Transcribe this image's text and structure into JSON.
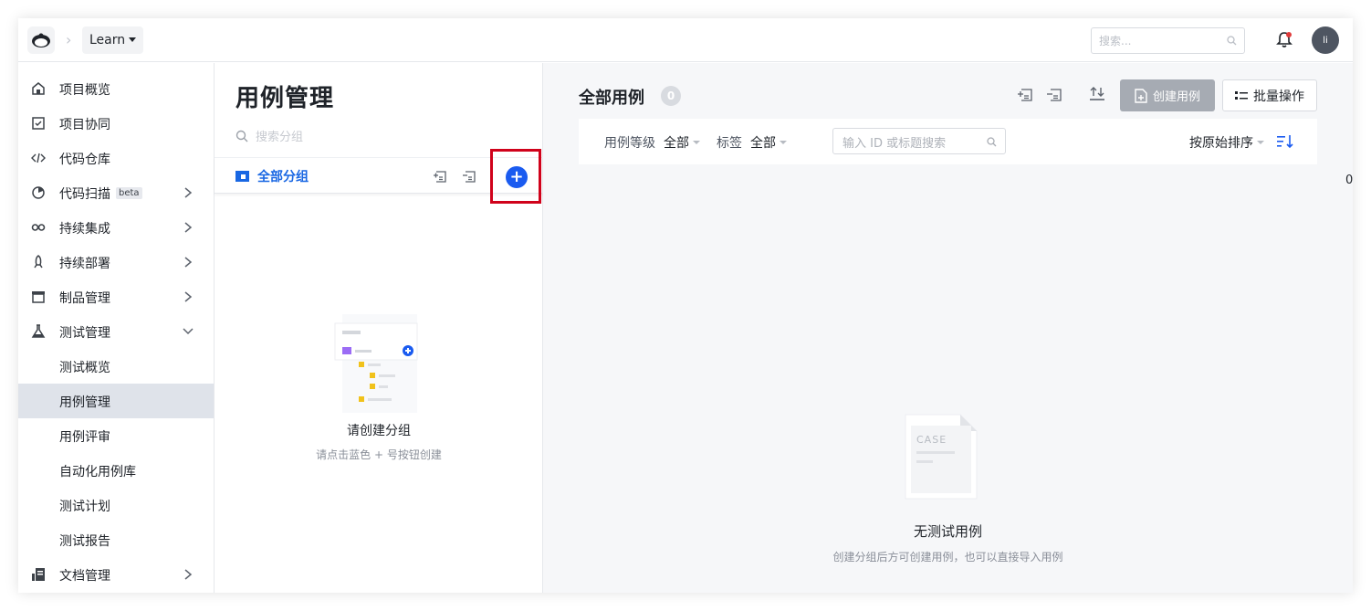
{
  "topbar": {
    "project_label": "Learn",
    "search_placeholder": "搜索...",
    "avatar_text": "li"
  },
  "sidebar": {
    "items": [
      {
        "label": "项目概览"
      },
      {
        "label": "项目协同"
      },
      {
        "label": "代码仓库"
      },
      {
        "label": "代码扫描",
        "badge": "beta"
      },
      {
        "label": "持续集成"
      },
      {
        "label": "持续部署"
      },
      {
        "label": "制品管理"
      },
      {
        "label": "测试管理"
      },
      {
        "label": "测试概览"
      },
      {
        "label": "用例管理"
      },
      {
        "label": "用例评审"
      },
      {
        "label": "自动化用例库"
      },
      {
        "label": "测试计划"
      },
      {
        "label": "测试报告"
      },
      {
        "label": "文档管理"
      }
    ]
  },
  "groups_panel": {
    "title": "用例管理",
    "search_placeholder": "搜索分组",
    "all_groups_label": "全部分组",
    "empty_title": "请创建分组",
    "empty_hint": "请点击蓝色 + 号按钮创建",
    "add_symbol": "+"
  },
  "cases_panel": {
    "title": "全部用例",
    "count": "0",
    "create_label": "创建用例",
    "batch_label": "批量操作",
    "filters": {
      "level_label": "用例等级",
      "level_value": "全部",
      "tag_label": "标签",
      "tag_value": "全部",
      "search_placeholder": "输入 ID 或标题搜索",
      "sort_label": "按原始排序"
    },
    "empty_title": "无测试用例",
    "empty_hint": "创建分组后方可创建用例，也可以直接导入用例",
    "illustration_text": "CASE"
  },
  "stray_text": "0",
  "colors": {
    "accent": "#1a5bf0",
    "link": "#1967e3",
    "highlight": "#d0021b",
    "active_nav": "#dfe3ea"
  }
}
